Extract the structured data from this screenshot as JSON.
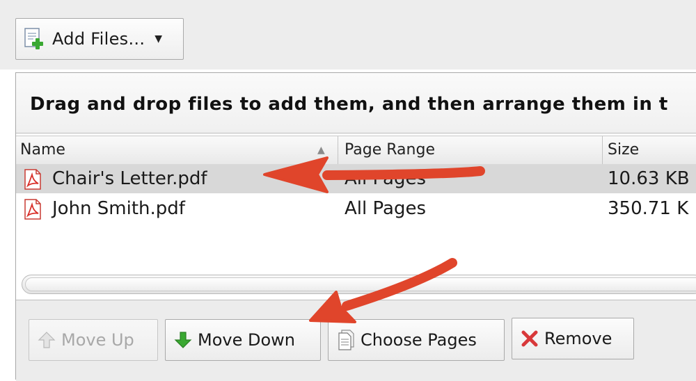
{
  "toolbar": {
    "add_files_label": "Add Files...",
    "add_files_icon": "add-file-icon",
    "dropdown_icon": "chevron-down-icon"
  },
  "instruction": "Drag and drop files to add them, and then arrange them in t",
  "table": {
    "columns": [
      {
        "label": "Name",
        "sorted": "ascending"
      },
      {
        "label": "Page Range"
      },
      {
        "label": "Size"
      }
    ],
    "rows": [
      {
        "name": "Chair's Letter.pdf",
        "page_range": "All Pages",
        "size": "10.63 KB",
        "selected": true,
        "icon": "pdf-icon"
      },
      {
        "name": "John Smith.pdf",
        "page_range": "All Pages",
        "size": "350.71 K",
        "selected": false,
        "icon": "pdf-icon"
      }
    ]
  },
  "buttons": {
    "move_up": {
      "label": "Move Up",
      "enabled": false,
      "icon": "arrow-up-icon"
    },
    "move_down": {
      "label": "Move Down",
      "enabled": true,
      "icon": "arrow-down-icon"
    },
    "choose_pages": {
      "label": "Choose Pages",
      "enabled": true,
      "icon": "document-icon"
    },
    "remove": {
      "label": "Remove",
      "enabled": true,
      "icon": "x-icon"
    }
  },
  "colors": {
    "annotation_arrow": "#e0452b",
    "pdf_red": "#d9302a",
    "move_down_green": "#3aa832",
    "remove_red": "#d8383a",
    "selected_row": "#d8d8d8"
  }
}
